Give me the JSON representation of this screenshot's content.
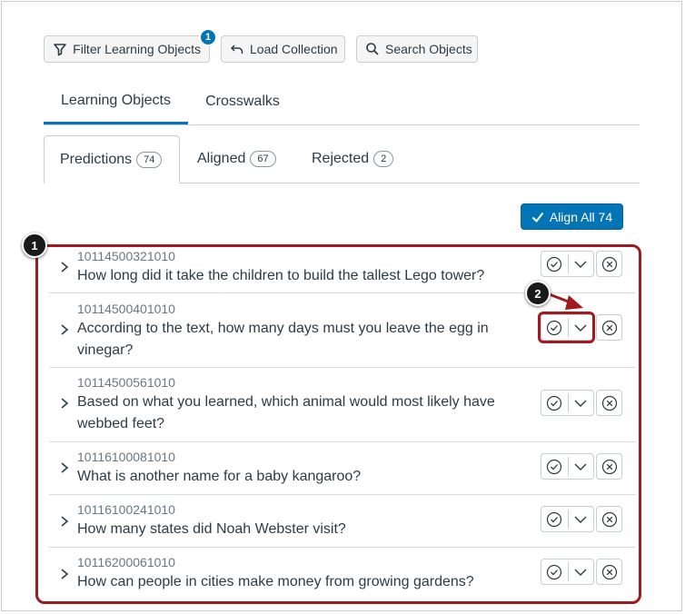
{
  "toolbar": {
    "filter_label": "Filter Learning Objects",
    "filter_badge": "1",
    "load_label": "Load Collection",
    "search_label": "Search Objects"
  },
  "primary_tabs": [
    {
      "label": "Learning Objects",
      "active": true
    },
    {
      "label": "Crosswalks",
      "active": false
    }
  ],
  "secondary_tabs": [
    {
      "label": "Predictions",
      "count": "74",
      "active": true
    },
    {
      "label": "Aligned",
      "count": "67",
      "active": false
    },
    {
      "label": "Rejected",
      "count": "2",
      "active": false
    }
  ],
  "align_all_label": "Align All 74",
  "items": [
    {
      "id": "10114500321010",
      "question": "How long did it take the children to build the tallest Lego tower?"
    },
    {
      "id": "10114500401010",
      "question": "According to the text, how many days must you leave the egg in vinegar?"
    },
    {
      "id": "10114500561010",
      "question": "Based on what you learned, which animal would most likely have webbed feet?"
    },
    {
      "id": "10116100081010",
      "question": "What is another name for a baby kangaroo?"
    },
    {
      "id": "10116100241010",
      "question": "How many states did Noah Webster visit?"
    },
    {
      "id": "10116200061010",
      "question": "How can people in cities make money from growing gardens?"
    }
  ],
  "callouts": [
    "1",
    "2"
  ],
  "colors": {
    "accent": "#0374b5",
    "callout": "#a01a1f"
  },
  "icons": [
    "filter-icon",
    "undo-icon",
    "search-icon",
    "checkmark-icon",
    "chevron-right-icon",
    "check-circle-icon",
    "chevron-down-icon",
    "x-circle-icon"
  ]
}
